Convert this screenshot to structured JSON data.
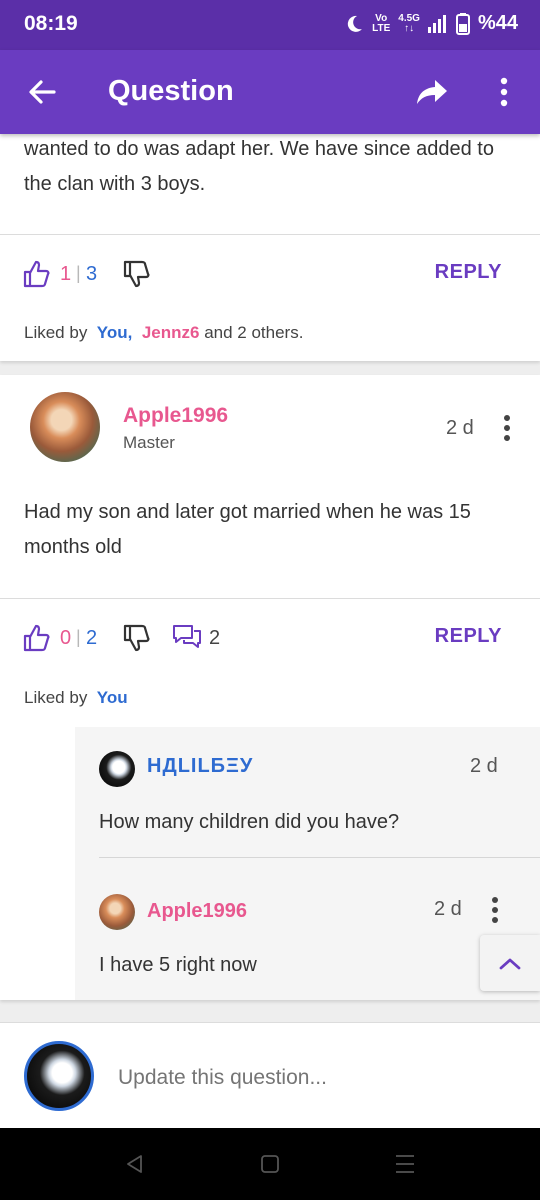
{
  "status_bar": {
    "time": "08:19",
    "network_top": "Vo",
    "network_bottom": "LTE",
    "gen_top": "4.5G",
    "gen_bottom": "↑↓",
    "battery": "%44"
  },
  "app_bar": {
    "title": "Question"
  },
  "answer1": {
    "text": "wanted to do was adapt her. We have since added to the clan with 3 boys.",
    "likes": "1",
    "separator": "|",
    "total": "3",
    "reply_label": "REPLY",
    "liked_by_prefix": "Liked by",
    "liked_by_user1": "You,",
    "liked_by_user2": "Jennz6",
    "liked_by_suffix": "and 2 others."
  },
  "answer2": {
    "username": "Apple1996",
    "rank": "Master",
    "time": "2 d",
    "text": "Had my son and later got married when he was 15 months old",
    "likes": "0",
    "separator": "|",
    "total": "2",
    "comments": "2",
    "reply_label": "REPLY",
    "liked_by_prefix": "Liked by",
    "liked_by_user1": "You",
    "replies": [
      {
        "username": "НДLILБΞУ",
        "time": "2 d",
        "text": "How many children did you have?"
      },
      {
        "username": "Apple1996",
        "time": "2 d",
        "text": "I have 5 right now"
      }
    ]
  },
  "compose": {
    "placeholder": "Update this question..."
  },
  "icons": [
    "back-arrow-icon",
    "share-icon",
    "more-vert-icon",
    "thumbs-up-icon",
    "thumbs-down-icon",
    "comment-icon",
    "chevron-up-icon",
    "moon-icon",
    "signal-icon",
    "battery-icon"
  ],
  "colors": {
    "primary": "#6a3cc1",
    "status": "#5b2fa8",
    "pink": "#e8588f",
    "blue": "#2e6bd1"
  }
}
